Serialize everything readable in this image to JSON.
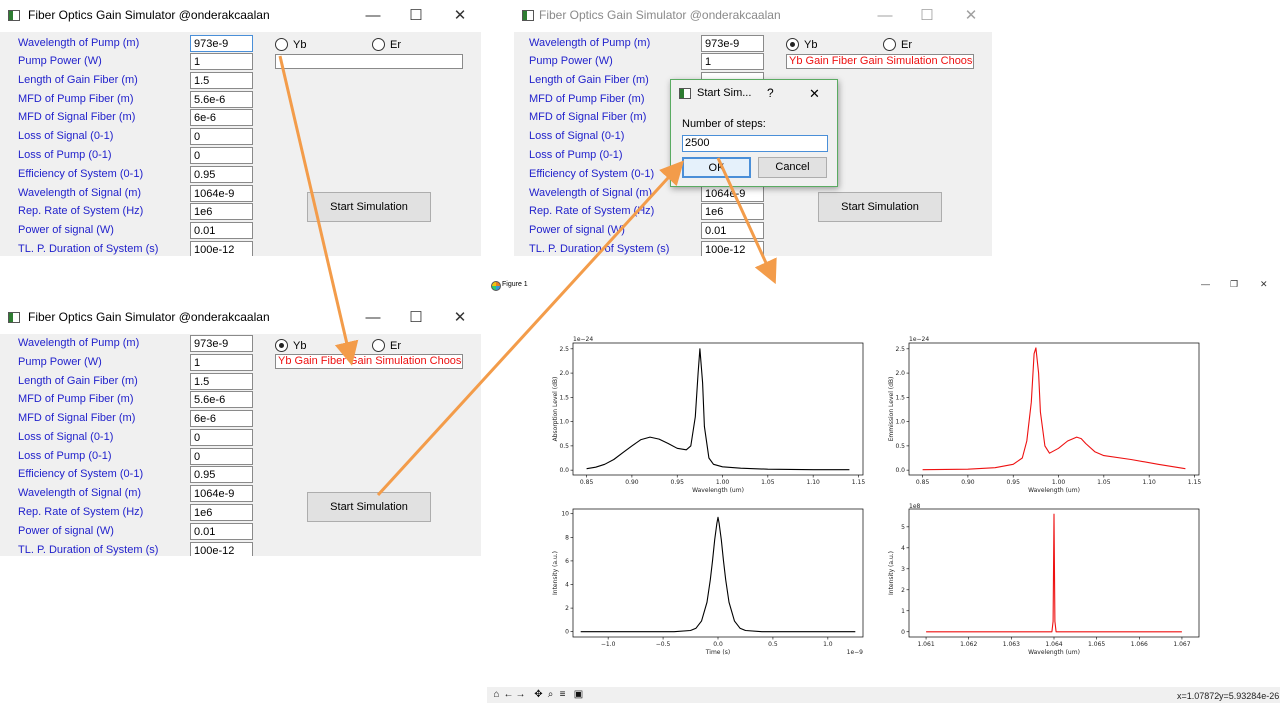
{
  "app_title": "Fiber Optics Gain Simulator @onderakcaalan",
  "window_controls": {
    "minimize": "—",
    "maximize": "☐",
    "close": "✕"
  },
  "labels": [
    "Wavelength of Pump (m)",
    "Pump Power (W)",
    "Length of Gain Fiber (m)",
    "MFD of Pump Fiber (m)",
    "MFD of Signal Fiber (m)",
    "Loss of Signal (0-1)",
    "Loss of Pump (0-1)",
    "Efficiency of System (0-1)",
    "Wavelength of Signal (m)",
    "Rep. Rate of System (Hz)",
    "Power of signal (W)",
    "TL. P. Duration of System (s)"
  ],
  "values": [
    "973e-9",
    "1",
    "1.5",
    "5.6e-6",
    "6e-6",
    "0",
    "0",
    "0.95",
    "1064e-9",
    "1e6",
    "0.01",
    "100e-12"
  ],
  "values_partial": [
    "973e-9",
    "1",
    "1.5",
    "",
    "",
    "",
    "",
    "",
    "1064e-9",
    "1e6",
    "0.01",
    "100e-12"
  ],
  "radio_yb": "Yb",
  "radio_er": "Er",
  "status_text": "Yb Gain Fiber Gain Simulation Choosen",
  "start_button": "Start Simulation",
  "dialog": {
    "title": "Start Sim...",
    "help": "?",
    "close": "✕",
    "prompt": "Number of steps:",
    "value": "2500",
    "ok": "OK",
    "cancel": "Cancel"
  },
  "figure": {
    "title": "Figure 1",
    "controls": {
      "minimize": "—",
      "restore": "❐",
      "close": "✕"
    },
    "coords": {
      "x": "x=1.07872",
      "y": "y=5.93284e-26"
    }
  },
  "toolbar_icons": [
    "home-icon",
    "back-icon",
    "forward-icon",
    "pan-icon",
    "zoom-icon",
    "configure-icon",
    "save-icon"
  ],
  "colors": {
    "label_blue": "#2222cc",
    "status_red": "#ee1111",
    "arrow_orange": "#f39c4a",
    "dialog_border": "#5aab62",
    "series_black": "#000000",
    "series_red": "#ee1111"
  },
  "chart_data": [
    {
      "type": "line",
      "ylabel": "Absorption Level (dB)",
      "xlabel": "Wavelength (um)",
      "x_ticks": [
        "0.85",
        "0.90",
        "0.95",
        "1.00",
        "1.05",
        "1.10",
        "1.15"
      ],
      "y_ticks": [
        "0.0",
        "0.5",
        "1.0",
        "1.5",
        "2.0",
        "2.5"
      ],
      "offset": "1e−24",
      "xlim": [
        0.835,
        1.155
      ],
      "ylim": [
        -0.1,
        2.62
      ],
      "color": "#000000",
      "x": [
        0.85,
        0.86,
        0.87,
        0.88,
        0.89,
        0.9,
        0.91,
        0.92,
        0.93,
        0.94,
        0.95,
        0.96,
        0.965,
        0.97,
        0.973,
        0.975,
        0.978,
        0.98,
        0.985,
        0.99,
        1.0,
        1.02,
        1.05,
        1.1,
        1.14
      ],
      "y": [
        0.03,
        0.06,
        0.12,
        0.22,
        0.36,
        0.5,
        0.63,
        0.68,
        0.64,
        0.55,
        0.45,
        0.42,
        0.5,
        1.1,
        2.0,
        2.5,
        1.8,
        0.9,
        0.25,
        0.12,
        0.07,
        0.04,
        0.02,
        0.01,
        0.01
      ]
    },
    {
      "type": "line",
      "ylabel": "Emmission Level (dB)",
      "xlabel": "Wavelength (um)",
      "x_ticks": [
        "0.85",
        "0.90",
        "0.95",
        "1.00",
        "1.05",
        "1.10",
        "1.15"
      ],
      "y_ticks": [
        "0.0",
        "0.5",
        "1.0",
        "1.5",
        "2.0",
        "2.5"
      ],
      "offset": "1e−24",
      "xlim": [
        0.835,
        1.155
      ],
      "ylim": [
        -0.1,
        2.62
      ],
      "color": "#ee1111",
      "x": [
        0.85,
        0.9,
        0.93,
        0.95,
        0.96,
        0.965,
        0.97,
        0.973,
        0.975,
        0.978,
        0.98,
        0.985,
        0.99,
        1.0,
        1.01,
        1.02,
        1.025,
        1.03,
        1.04,
        1.05,
        1.08,
        1.11,
        1.14
      ],
      "y": [
        0.01,
        0.02,
        0.05,
        0.12,
        0.25,
        0.6,
        1.4,
        2.4,
        2.52,
        2.0,
        1.2,
        0.5,
        0.35,
        0.45,
        0.6,
        0.68,
        0.65,
        0.55,
        0.38,
        0.3,
        0.22,
        0.12,
        0.03
      ]
    },
    {
      "type": "line",
      "ylabel": "Intensity (a.u.)",
      "xlabel": "Time (s)",
      "x_ticks": [
        "−1.0",
        "−0.5",
        "0.0",
        "0.5",
        "1.0"
      ],
      "x_tick_values": [
        -1.0,
        -0.5,
        0.0,
        0.5,
        1.0
      ],
      "y_ticks": [
        "0",
        "2",
        "4",
        "6",
        "8",
        "10"
      ],
      "offset": "1e−9",
      "xlim": [
        -1.32,
        1.32
      ],
      "ylim": [
        -0.45,
        10.4
      ],
      "color": "#000000",
      "x": [
        -1.25,
        -0.4,
        -0.25,
        -0.2,
        -0.15,
        -0.1,
        -0.07,
        -0.05,
        -0.03,
        -0.01,
        0.0,
        0.01,
        0.03,
        0.05,
        0.07,
        0.1,
        0.15,
        0.2,
        0.25,
        0.4,
        1.25
      ],
      "y": [
        0,
        0,
        0.1,
        0.3,
        0.9,
        2.5,
        4.4,
        6.0,
        7.8,
        9.2,
        9.7,
        9.2,
        7.8,
        6.0,
        4.4,
        2.5,
        0.9,
        0.3,
        0.1,
        0,
        0
      ]
    },
    {
      "type": "line",
      "ylabel": "Intensity (a.u.)",
      "xlabel": "Wavelength (um)",
      "x_ticks": [
        "1.061",
        "1.062",
        "1.063",
        "1.064",
        "1.065",
        "1.066",
        "1.067"
      ],
      "x_tick_values": [
        1.061,
        1.062,
        1.063,
        1.064,
        1.065,
        1.066,
        1.067
      ],
      "y_ticks": [
        "0",
        "1",
        "2",
        "3",
        "4",
        "5"
      ],
      "offset": "1e8",
      "xlim": [
        1.0606,
        1.0674
      ],
      "ylim": [
        -0.25,
        5.85
      ],
      "color": "#ee1111",
      "x": [
        1.061,
        1.06395,
        1.06398,
        1.064,
        1.06402,
        1.06405,
        1.067
      ],
      "y": [
        0,
        0,
        0.5,
        5.6,
        0.5,
        0,
        0
      ]
    }
  ]
}
